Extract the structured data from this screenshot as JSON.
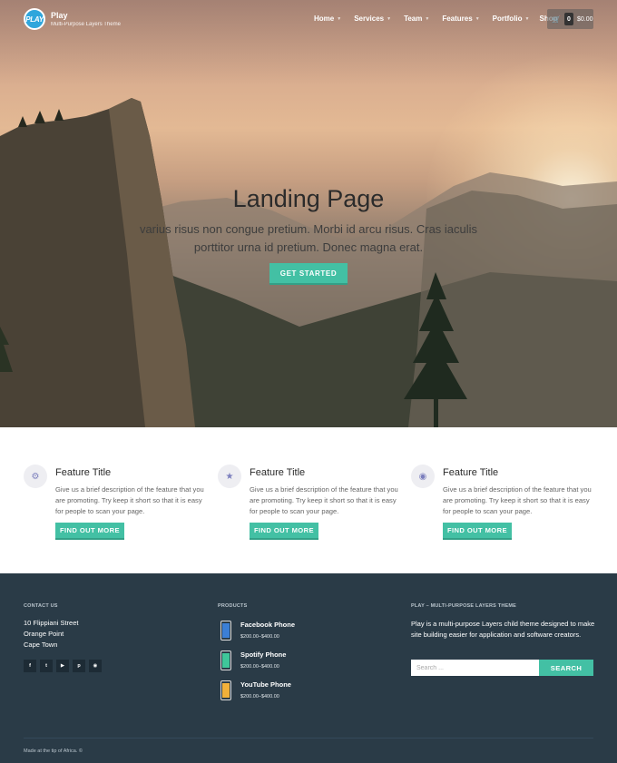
{
  "header": {
    "logo_text": "PLAY",
    "site_title": "Play",
    "tagline": "Multi-Purpose Layers Theme",
    "nav": [
      {
        "label": "Home",
        "has_caret": true
      },
      {
        "label": "Services",
        "has_caret": true
      },
      {
        "label": "Team",
        "has_caret": true
      },
      {
        "label": "Features",
        "has_caret": true
      },
      {
        "label": "Portfolio",
        "has_caret": true
      },
      {
        "label": "Shop",
        "has_caret": false
      }
    ],
    "cart": {
      "count": "0",
      "total": "$0.00"
    }
  },
  "hero": {
    "title": "Landing Page",
    "excerpt": "varius risus non congue pretium. Morbi id arcu risus. Cras iaculis porttitor urna id pretium. Donec magna erat.",
    "button_label": "GET STARTED"
  },
  "features": [
    {
      "icon": "gear-icon",
      "title": "Feature Title",
      "description": "Give us a brief description of the feature that you are promoting. Try keep it short so that it is easy for people to scan your page.",
      "button_label": "FIND OUT MORE"
    },
    {
      "icon": "star-icon",
      "title": "Feature Title",
      "description": "Give us a brief description of the feature that you are promoting. Try keep it short so that it is easy for people to scan your page.",
      "button_label": "FIND OUT MORE"
    },
    {
      "icon": "medal-icon",
      "title": "Feature Title",
      "description": "Give us a brief description of the feature that you are promoting. Try keep it short so that it is easy for people to scan your page.",
      "button_label": "FIND OUT MORE"
    }
  ],
  "footer": {
    "contact": {
      "heading": "CONTACT US",
      "address": [
        "10 Flippiani Street",
        "Orange Point",
        "Cape Town"
      ],
      "social_icons": [
        "facebook-icon",
        "twitter-icon",
        "youtube-icon",
        "pinterest-icon",
        "instagram-icon"
      ]
    },
    "products": {
      "heading": "PRODUCTS",
      "items": [
        {
          "name": "Facebook Phone",
          "price": "$200.00–$400.00",
          "color": "#3b7fd6"
        },
        {
          "name": "Spotify Phone",
          "price": "$200.00–$400.00",
          "color": "#3fc79a"
        },
        {
          "name": "YouTube Phone",
          "price": "$200.00–$400.00",
          "color": "#f2b13a"
        }
      ]
    },
    "about": {
      "heading": "PLAY – MULTI-PURPOSE LAYERS THEME",
      "text": "Play is a multi-purpose Layers child theme designed to make site building easier for application and software creators.",
      "search_placeholder": "Search ...",
      "search_button": "SEARCH"
    },
    "copyright": "Made at the tip of Africa. ©"
  },
  "colors": {
    "accent": "#43c0a4",
    "footer_bg": "#2a3b47",
    "logo": "#2fa6dc"
  }
}
